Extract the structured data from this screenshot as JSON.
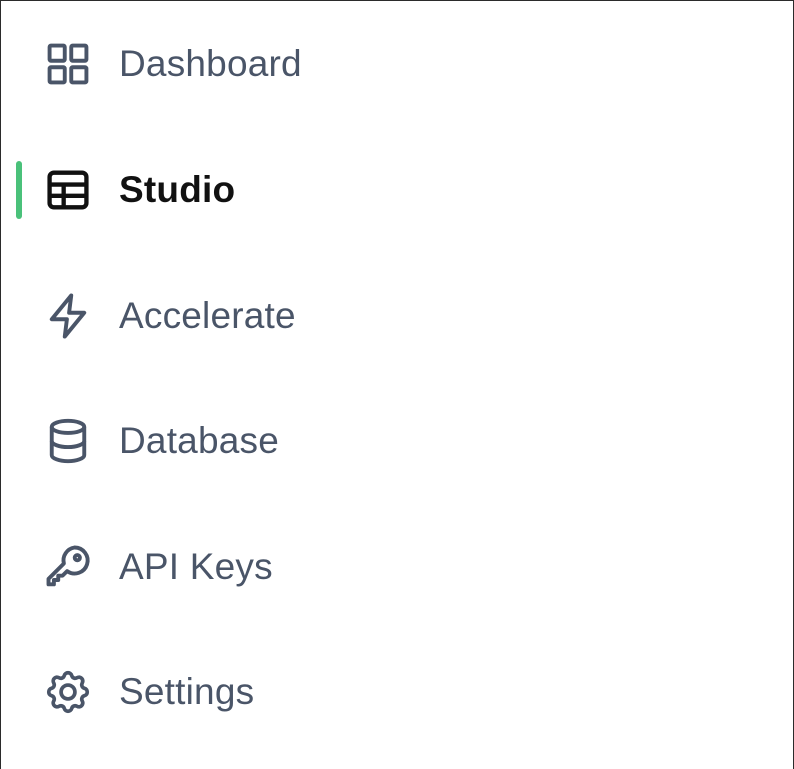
{
  "theme": {
    "accent": "#4ac17a",
    "text_muted": "#4a5568",
    "text_active": "#111111"
  },
  "sidebar": {
    "items": [
      {
        "label": "Dashboard",
        "icon": "grid-icon",
        "active": false
      },
      {
        "label": "Studio",
        "icon": "table-icon",
        "active": true
      },
      {
        "label": "Accelerate",
        "icon": "lightning-bolt-icon",
        "active": false
      },
      {
        "label": "Database",
        "icon": "database-icon",
        "active": false
      },
      {
        "label": "API Keys",
        "icon": "key-icon",
        "active": false
      },
      {
        "label": "Settings",
        "icon": "gear-icon",
        "active": false
      }
    ]
  }
}
